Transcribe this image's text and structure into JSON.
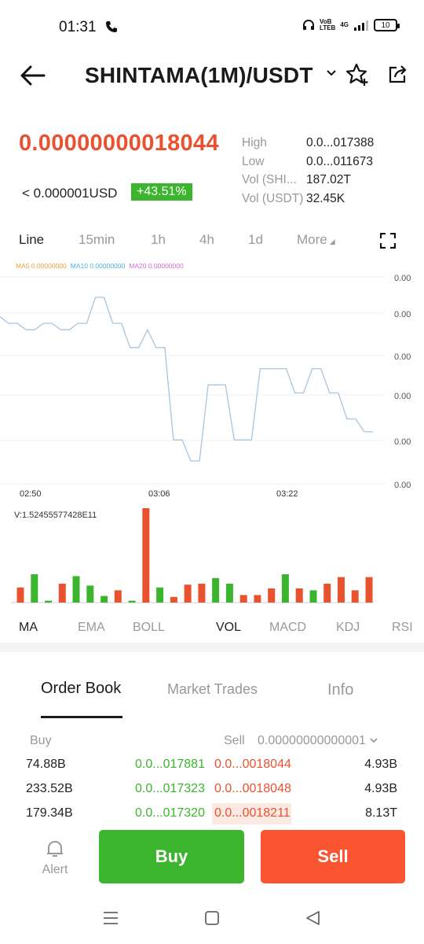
{
  "status_bar": {
    "time": "01:31",
    "net1": "VoB",
    "net2": "LTEB",
    "net3": "4G",
    "battery": "10"
  },
  "header": {
    "title": "SHINTAMA(1M)/USDT"
  },
  "ticker": {
    "last_price": "0.00000000018044",
    "usd_price": "< 0.000001USD",
    "change": "+43.51%",
    "stats": [
      {
        "label": "High",
        "value": "0.0...017388"
      },
      {
        "label": "Low",
        "value": "0.0...011673"
      },
      {
        "label": "Vol (SHI...",
        "value": "187.02T"
      },
      {
        "label": "Vol (USDT)",
        "value": "32.45K"
      }
    ]
  },
  "timeframes": {
    "tabs": [
      "Line",
      "15min",
      "1h",
      "4h",
      "1d"
    ],
    "more": "More",
    "active": "Line"
  },
  "ma_legend": [
    {
      "label": "MA5 0.00000000",
      "color": "#e6a23c"
    },
    {
      "label": "MA10 0.00000000",
      "color": "#4fb0d9"
    },
    {
      "label": "MA20 0.00000000",
      "color": "#d46bd0"
    }
  ],
  "chart": {
    "y_labels": [
      "0.00",
      "0.00",
      "0.00",
      "0.00",
      "0.00",
      "0.00"
    ],
    "x_labels": [
      "02:50",
      "03:06",
      "03:22"
    ],
    "price_line": [
      0.5,
      0.46,
      0.46,
      0.42,
      0.42,
      0.46,
      0.46,
      0.42,
      0.42,
      0.46,
      0.46,
      0.62,
      0.62,
      0.46,
      0.46,
      0.31,
      0.31,
      0.42,
      0.31,
      0.31,
      -0.26,
      -0.26,
      -0.39,
      -0.39,
      0.08,
      0.08,
      0.08,
      -0.26,
      -0.26,
      -0.26,
      0.18,
      0.18,
      0.18,
      0.18,
      0.03,
      0.03,
      0.18,
      0.18,
      0.03,
      0.03,
      -0.13,
      -0.13,
      -0.21,
      -0.21
    ],
    "volume_label": "V:1.52455577428E11",
    "volume_bars": [
      {
        "v": 0.16,
        "c": "red"
      },
      {
        "v": 0.3,
        "c": "green"
      },
      {
        "v": 0.02,
        "c": "green"
      },
      {
        "v": 0.2,
        "c": "red"
      },
      {
        "v": 0.28,
        "c": "green"
      },
      {
        "v": 0.18,
        "c": "green"
      },
      {
        "v": 0.07,
        "c": "green"
      },
      {
        "v": 0.13,
        "c": "red"
      },
      {
        "v": 0.02,
        "c": "green"
      },
      {
        "v": 1.0,
        "c": "red"
      },
      {
        "v": 0.16,
        "c": "green"
      },
      {
        "v": 0.06,
        "c": "red"
      },
      {
        "v": 0.19,
        "c": "red"
      },
      {
        "v": 0.2,
        "c": "red"
      },
      {
        "v": 0.26,
        "c": "green"
      },
      {
        "v": 0.2,
        "c": "green"
      },
      {
        "v": 0.08,
        "c": "red"
      },
      {
        "v": 0.08,
        "c": "red"
      },
      {
        "v": 0.15,
        "c": "red"
      },
      {
        "v": 0.3,
        "c": "green"
      },
      {
        "v": 0.15,
        "c": "red"
      },
      {
        "v": 0.13,
        "c": "green"
      },
      {
        "v": 0.2,
        "c": "red"
      },
      {
        "v": 0.27,
        "c": "red"
      },
      {
        "v": 0.13,
        "c": "red"
      },
      {
        "v": 0.27,
        "c": "red"
      }
    ]
  },
  "indicators": {
    "tabs": [
      "MA",
      "EMA",
      "BOLL",
      "VOL",
      "MACD",
      "KDJ",
      "RSI"
    ]
  },
  "order_book": {
    "tabs": [
      "Order Book",
      "Market Trades",
      "Info"
    ],
    "buy_header": "Buy",
    "sell_header": "Sell",
    "precision": "0.00000000000001",
    "rows": [
      {
        "buy_qty": "74.88B",
        "buy_price": "0.0...017881",
        "sell_price": "0.0...0018044",
        "sell_qty": "4.93B",
        "depth": 0.0
      },
      {
        "buy_qty": "233.52B",
        "buy_price": "0.0...017323",
        "sell_price": "0.0...0018048",
        "sell_qty": "4.93B",
        "depth": 0.0
      },
      {
        "buy_qty": "179.34B",
        "buy_price": "0.0...017320",
        "sell_price": "0.0...0018211",
        "sell_qty": "8.13T",
        "depth": 0.42
      }
    ]
  },
  "actions": {
    "alert": "Alert",
    "buy": "Buy",
    "sell": "Sell"
  },
  "colors": {
    "up": "#3cb52e",
    "down": "#e9522e",
    "line": "#a9c4dd"
  }
}
